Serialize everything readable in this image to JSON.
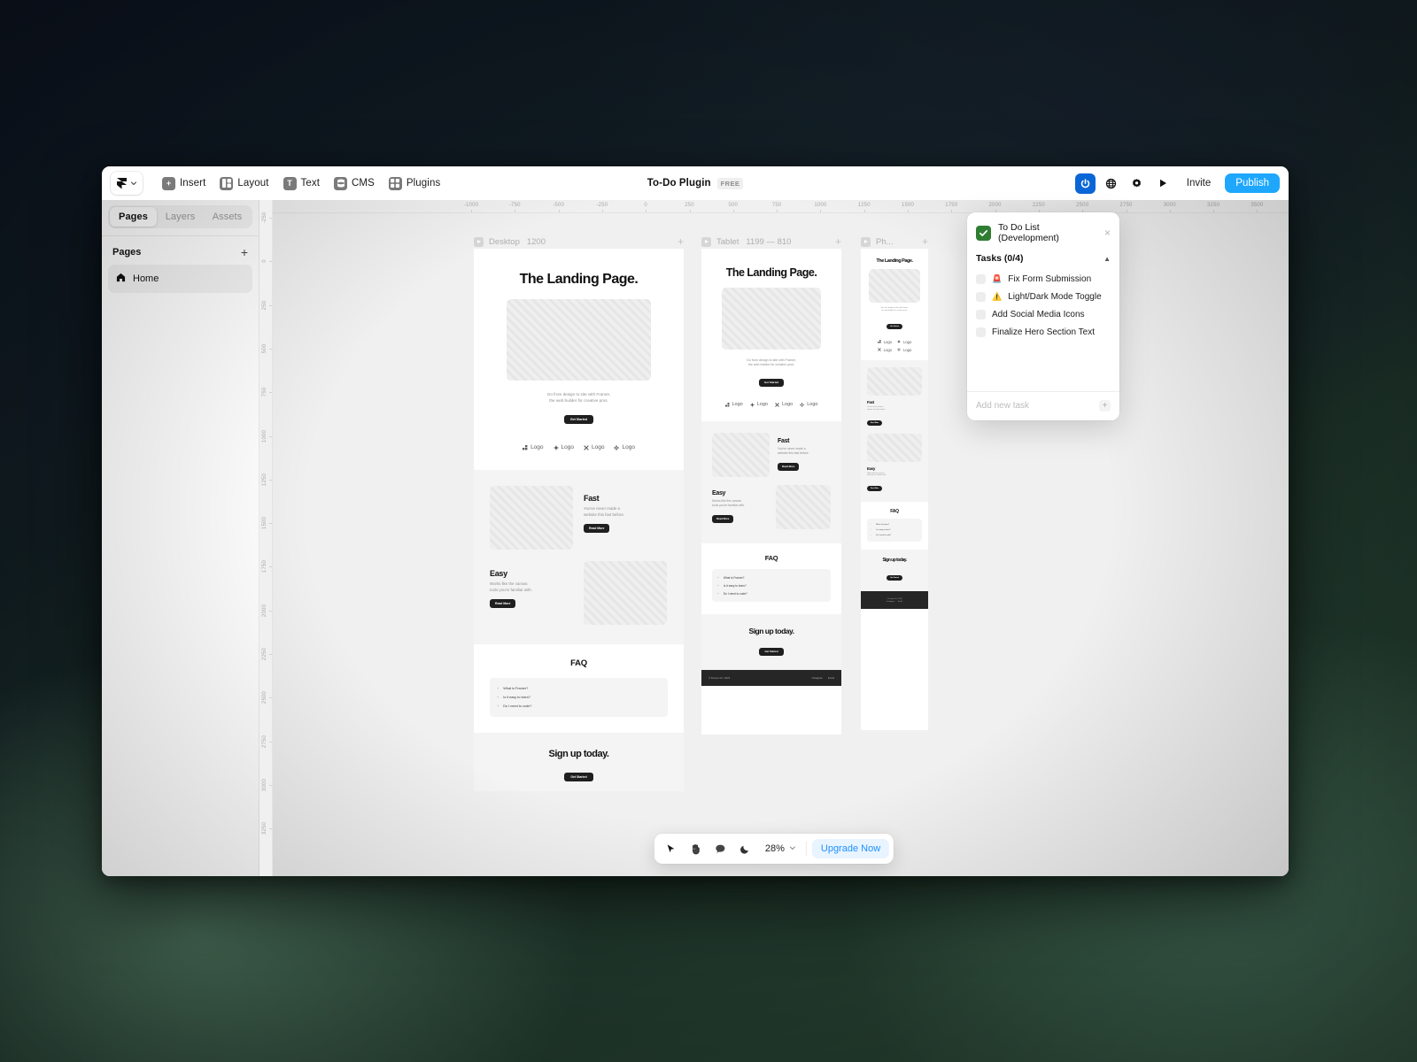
{
  "toolbar": {
    "logo_icon": "framer-logo-icon",
    "chevron_icon": "chevron-down-icon",
    "items": [
      {
        "label": "Insert",
        "icon": "plus-square-icon"
      },
      {
        "label": "Layout",
        "icon": "layout-columns-icon"
      },
      {
        "label": "Text",
        "icon": "text-t-icon"
      },
      {
        "label": "CMS",
        "icon": "database-icon"
      },
      {
        "label": "Plugins",
        "icon": "grid-squares-icon"
      }
    ],
    "title": "To-Do Plugin",
    "badge": "FREE",
    "right_icons": [
      {
        "name": "plugin-power-icon",
        "active": true
      },
      {
        "name": "globe-icon",
        "active": false
      },
      {
        "name": "settings-gear-icon",
        "active": false
      },
      {
        "name": "play-preview-icon",
        "active": false
      }
    ],
    "invite_label": "Invite",
    "publish_label": "Publish"
  },
  "sidebar": {
    "tabs": [
      {
        "label": "Pages",
        "selected": true
      },
      {
        "label": "Layers",
        "selected": false
      },
      {
        "label": "Assets",
        "selected": false
      }
    ],
    "section_title": "Pages",
    "add_icon": "plus-icon",
    "pages": [
      {
        "label": "Home",
        "icon": "home-icon"
      }
    ]
  },
  "rulers": {
    "horizontal": [
      "-1000",
      "-750",
      "-500",
      "-250",
      "0",
      "250",
      "500",
      "750",
      "1000",
      "1250",
      "1500",
      "1750",
      "2000",
      "2250",
      "2500",
      "2750",
      "3000",
      "3250",
      "3500"
    ],
    "vertical": [
      "-250",
      "0",
      "250",
      "500",
      "750",
      "1000",
      "1250",
      "1500",
      "1750",
      "2000",
      "2250",
      "2500",
      "2750",
      "3000",
      "3250"
    ]
  },
  "frames": [
    {
      "name": "Desktop",
      "dimensions": "1200",
      "add_icon": "plus-icon"
    },
    {
      "name": "Tablet",
      "dimensions": "1199 — 810",
      "add_icon": "plus-icon"
    },
    {
      "name": "Ph...",
      "dimensions": "",
      "add_icon": "plus-icon"
    }
  ],
  "landing_page": {
    "hero_title": "The Landing Page.",
    "hero_subtitle_line1": "Go from design to site with Framer,",
    "hero_subtitle_line2": "the web builder for creative pros.",
    "hero_cta": "Get Started",
    "logos": [
      {
        "label": "Logo",
        "icon": "blocks-logo-icon"
      },
      {
        "label": "Logo",
        "icon": "diamond-logo-icon"
      },
      {
        "label": "Logo",
        "icon": "x-logo-icon"
      },
      {
        "label": "Logo",
        "icon": "sparkle-logo-icon"
      }
    ],
    "features": [
      {
        "heading": "Fast",
        "body_line1": "You've never made a",
        "body_line2": "website this fast before.",
        "cta": "Read More"
      },
      {
        "heading": "Easy",
        "body_line1": "Works like the canvas",
        "body_line2": "tools you're familiar with.",
        "cta": "Read More"
      }
    ],
    "faq_heading": "FAQ",
    "faq_items": [
      "What is Framer?",
      "Is it easy to learn?",
      "Do I need to code?"
    ],
    "signup_heading": "Sign up today.",
    "signup_cta": "Get Started",
    "footer_copyright": "© Framer Inc. 2023",
    "footer_links": [
      "Instagram",
      "Email"
    ]
  },
  "todo_panel": {
    "badge_icon": "green-check-icon",
    "title": "To Do List (Development)",
    "close_icon": "close-icon",
    "tasks_label": "Tasks (0/4)",
    "collapse_icon": "chevron-up-icon",
    "tasks": [
      {
        "label": "Fix Form Submission",
        "emoji": "🚨",
        "checked": false
      },
      {
        "label": "Light/Dark Mode Toggle",
        "emoji": "⚠️",
        "checked": false
      },
      {
        "label": "Add Social Media Icons",
        "emoji": "",
        "checked": false
      },
      {
        "label": "Finalize Hero Section Text",
        "emoji": "",
        "checked": false
      }
    ],
    "new_task_placeholder": "Add new task",
    "add_icon": "plus-icon"
  },
  "bottom_bar": {
    "tools": [
      {
        "name": "cursor-select-icon"
      },
      {
        "name": "hand-pan-icon"
      },
      {
        "name": "comment-bubble-icon"
      },
      {
        "name": "moon-dark-mode-icon"
      }
    ],
    "zoom_level": "28%",
    "zoom_chevron_icon": "chevron-down-icon",
    "upgrade_label": "Upgrade Now"
  },
  "colors": {
    "accent_blue": "#1ea7fd",
    "plugin_active": "#0a66d6",
    "todo_green": "#2f7d32",
    "upgrade_text": "#1e90ff"
  }
}
